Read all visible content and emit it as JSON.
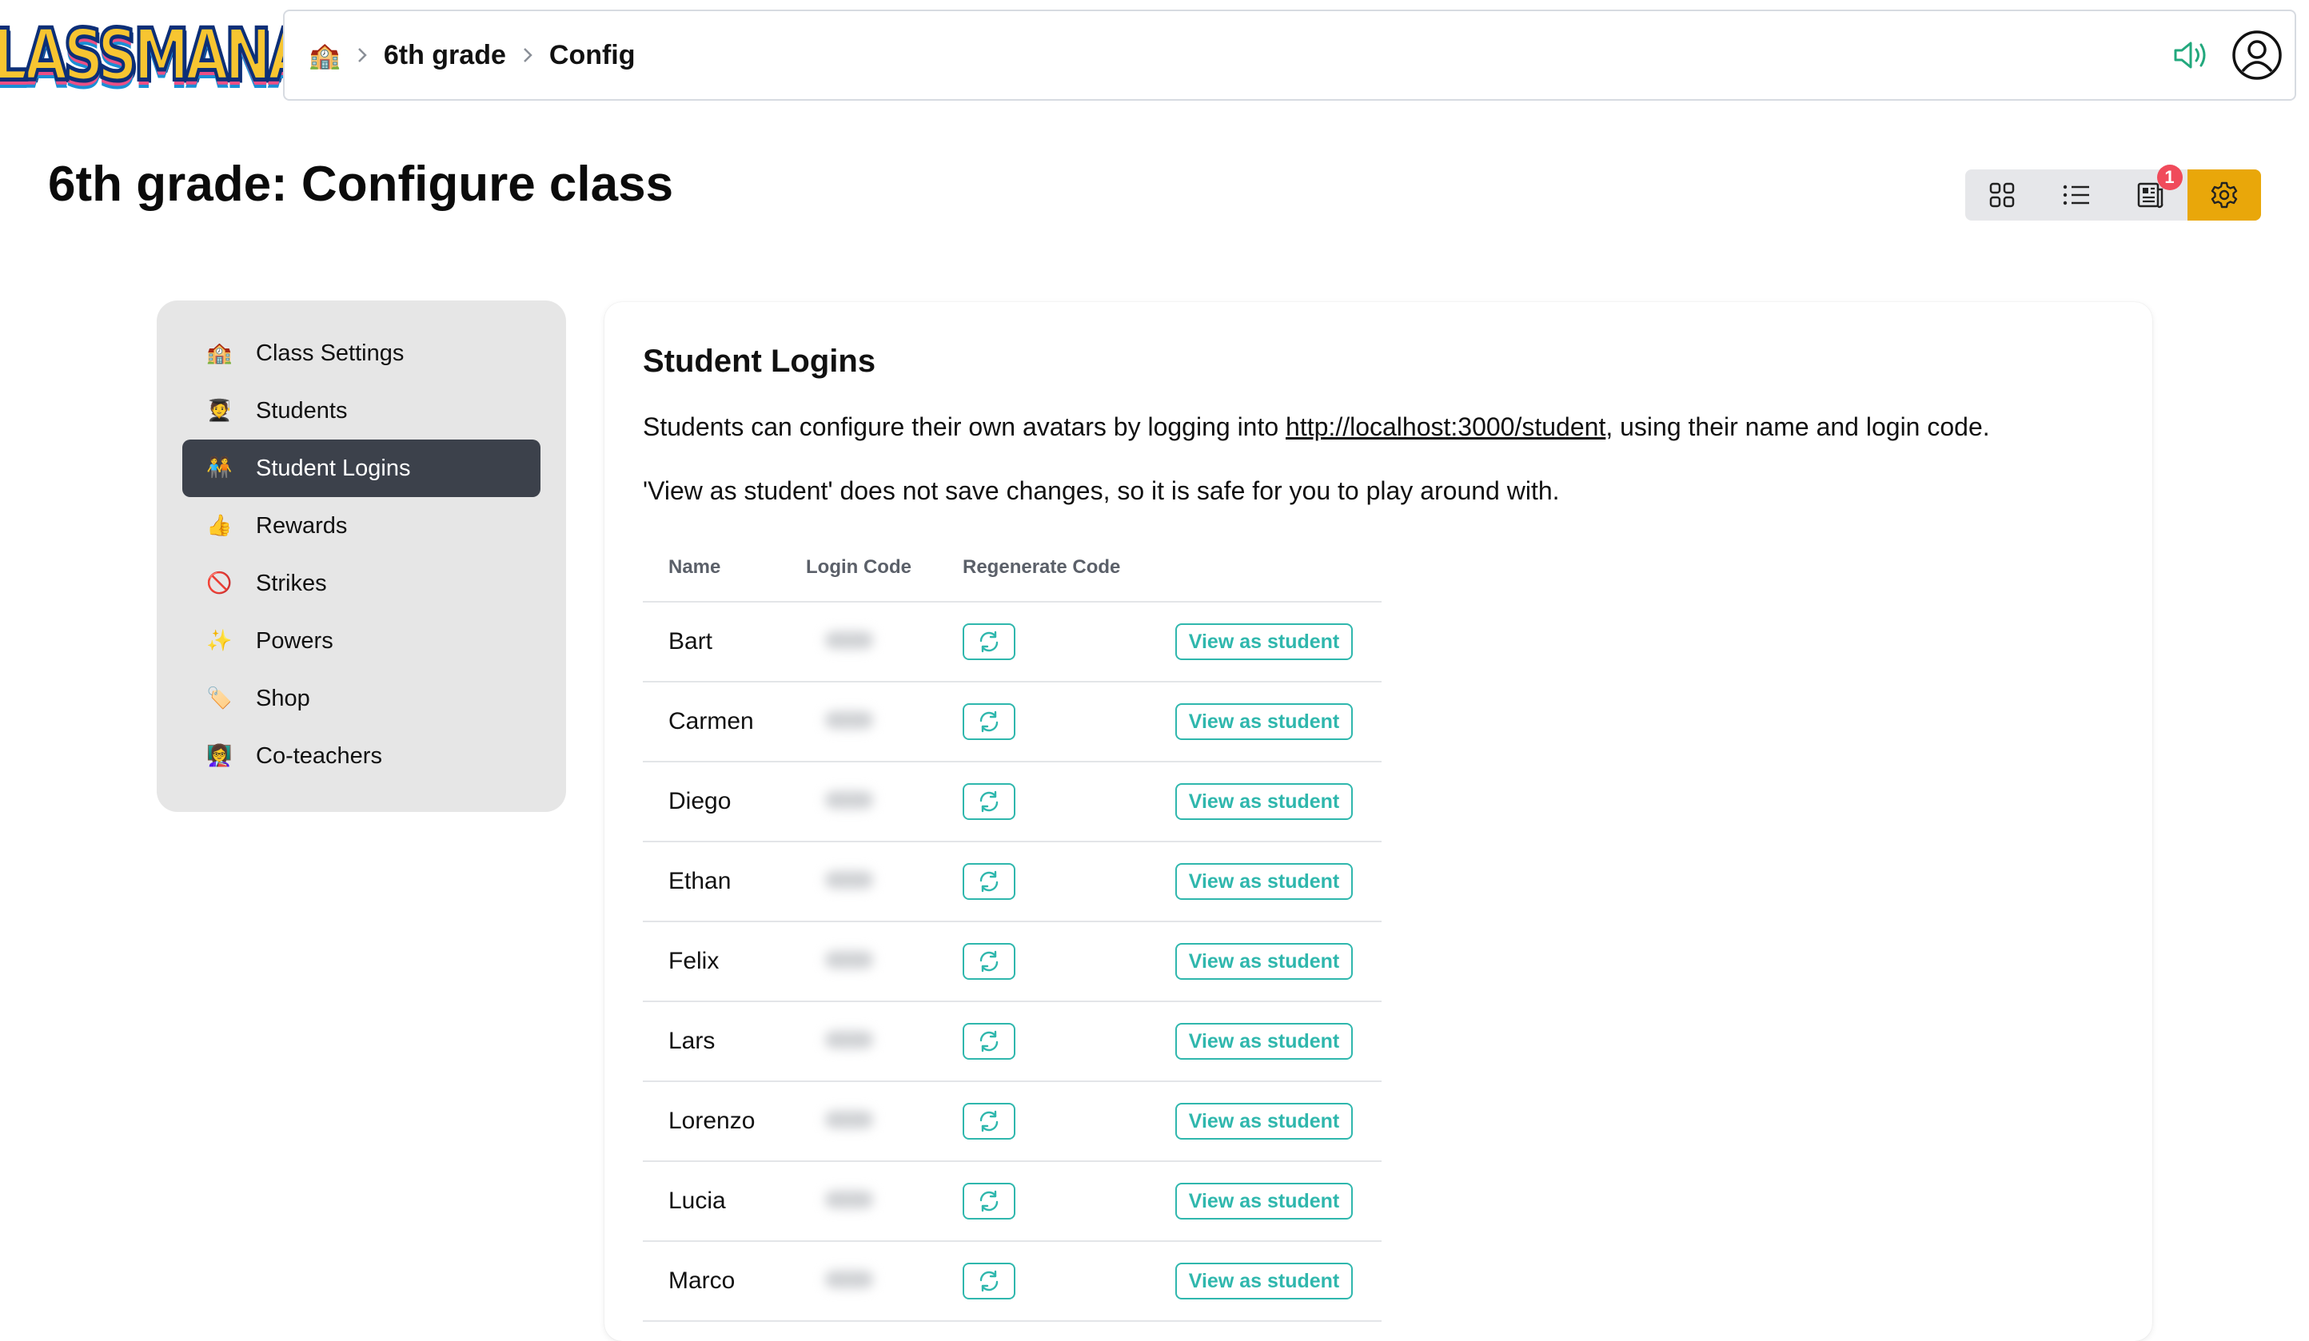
{
  "logo": {
    "text": "CLASSMANA"
  },
  "breadcrumb": {
    "home_icon": "🏫",
    "items": [
      "6th grade",
      "Config"
    ]
  },
  "page": {
    "title": "6th grade: Configure class"
  },
  "view_switch": {
    "buttons": [
      "grid-icon",
      "list-icon",
      "newspaper-icon",
      "gear-icon"
    ],
    "badge_count": "1",
    "active": "gear-icon"
  },
  "sidebar": {
    "items": [
      {
        "emoji": "🏫",
        "label": "Class Settings"
      },
      {
        "emoji": "🧑‍🎓",
        "label": "Students"
      },
      {
        "emoji": "🧑‍🤝‍🧑",
        "label": "Student Logins",
        "active": true
      },
      {
        "emoji": "👍",
        "label": "Rewards"
      },
      {
        "emoji": "🚫",
        "label": "Strikes"
      },
      {
        "emoji": "✨",
        "label": "Powers"
      },
      {
        "emoji": "🏷️",
        "label": "Shop"
      },
      {
        "emoji": "👩‍🏫",
        "label": "Co-teachers"
      }
    ]
  },
  "main": {
    "title": "Student Logins",
    "description_prefix": "Students can configure their own avatars by logging into ",
    "description_link": "http://localhost:3000/student",
    "description_suffix": ", using their name and login code.",
    "note": "'View as student' does not save changes, so it is safe for you to play around with.",
    "table": {
      "headers": [
        "Name",
        "Login Code",
        "Regenerate Code"
      ],
      "view_label": "View as student",
      "rows": [
        "Bart",
        "Carmen",
        "Diego",
        "Ethan",
        "Felix",
        "Lars",
        "Lorenzo",
        "Lucia",
        "Marco"
      ]
    }
  },
  "colors": {
    "accent": "#e9a70a",
    "teal": "#2fb7ad",
    "sidebar_active": "#3c414b",
    "badge": "#f04b5b"
  }
}
